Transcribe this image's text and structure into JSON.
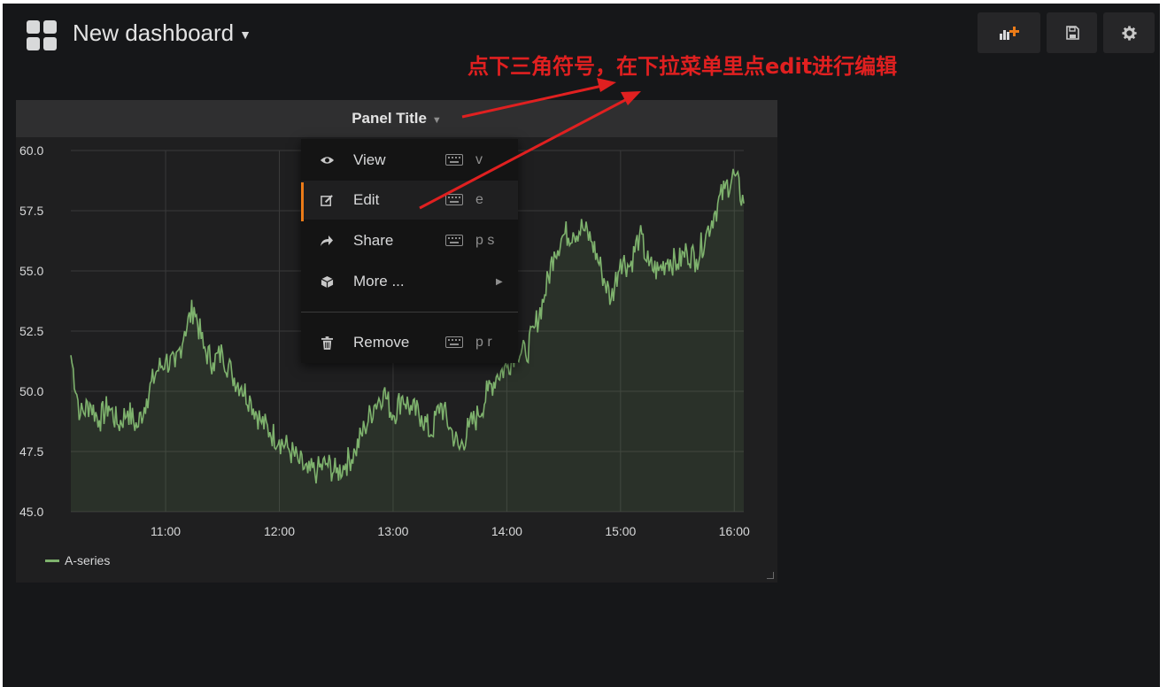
{
  "header": {
    "dashboard_title": "New dashboard",
    "annotation": "点下三角符号，在下拉菜单里点edit进行编辑",
    "buttons": [
      "add-panel-icon",
      "save-icon",
      "gear-icon"
    ]
  },
  "panel": {
    "title": "Panel Title",
    "menu": {
      "items": [
        {
          "label": "View",
          "icon": "eye-icon",
          "shortcut": "v"
        },
        {
          "label": "Edit",
          "icon": "edit-icon",
          "shortcut": "e"
        },
        {
          "label": "Share",
          "icon": "share-icon",
          "shortcut": "p s"
        },
        {
          "label": "More ...",
          "icon": "cube-icon",
          "shortcut": ""
        },
        {
          "label": "Remove",
          "icon": "trash-icon",
          "shortcut": "p r"
        }
      ]
    }
  },
  "colors": {
    "series": "#7eb26d",
    "annotation": "#e02020",
    "accent": "#eb7b18"
  },
  "chart_data": {
    "type": "line",
    "title": "Panel Title",
    "yticks": [
      "60.0",
      "57.5",
      "55.0",
      "52.5",
      "50.0",
      "47.5",
      "45.0"
    ],
    "ylim": [
      45,
      60
    ],
    "xticks": [
      "11:00",
      "12:00",
      "13:00",
      "14:00",
      "15:00",
      "16:00"
    ],
    "xlim": [
      "10:10",
      "16:05"
    ],
    "grid": true,
    "legend_position": "bottom-left",
    "series": [
      {
        "name": "A-series",
        "x": [
          "10:10",
          "10:15",
          "10:20",
          "10:25",
          "10:30",
          "10:35",
          "10:40",
          "10:45",
          "10:50",
          "10:55",
          "11:00",
          "11:05",
          "11:10",
          "11:15",
          "11:20",
          "11:25",
          "11:30",
          "11:35",
          "11:40",
          "11:45",
          "11:50",
          "11:55",
          "12:00",
          "12:05",
          "12:10",
          "12:15",
          "12:20",
          "12:25",
          "12:30",
          "12:35",
          "12:40",
          "12:45",
          "12:50",
          "12:55",
          "13:00",
          "13:05",
          "13:10",
          "13:15",
          "13:20",
          "13:25",
          "13:30",
          "13:35",
          "13:40",
          "13:45",
          "13:50",
          "13:55",
          "14:00",
          "14:05",
          "14:10",
          "14:15",
          "14:20",
          "14:25",
          "14:30",
          "14:35",
          "14:40",
          "14:45",
          "14:50",
          "14:55",
          "15:00",
          "15:05",
          "15:10",
          "15:15",
          "15:20",
          "15:25",
          "15:30",
          "15:35",
          "15:40",
          "15:45",
          "15:50",
          "15:55",
          "16:00",
          "16:05"
        ],
        "y": [
          51.5,
          49.0,
          49.5,
          48.8,
          49.4,
          48.6,
          49.2,
          48.5,
          49.7,
          50.8,
          51.3,
          51.0,
          52.5,
          53.5,
          51.8,
          51.2,
          51.6,
          50.7,
          50.2,
          49.6,
          48.8,
          48.3,
          48.0,
          47.6,
          47.1,
          46.6,
          46.7,
          47.0,
          46.6,
          47.0,
          47.5,
          48.5,
          49.4,
          50.0,
          49.0,
          49.8,
          49.2,
          49.0,
          48.2,
          49.5,
          48.5,
          47.6,
          48.5,
          49.0,
          50.0,
          50.7,
          51.0,
          51.8,
          51.5,
          52.7,
          54.0,
          55.8,
          56.5,
          56.6,
          56.8,
          56.2,
          55.0,
          53.8,
          55.5,
          55.2,
          56.5,
          55.2,
          55.0,
          55.5,
          55.3,
          55.8,
          55.5,
          56.5,
          57.5,
          58.4,
          59.0,
          57.8
        ]
      }
    ]
  }
}
